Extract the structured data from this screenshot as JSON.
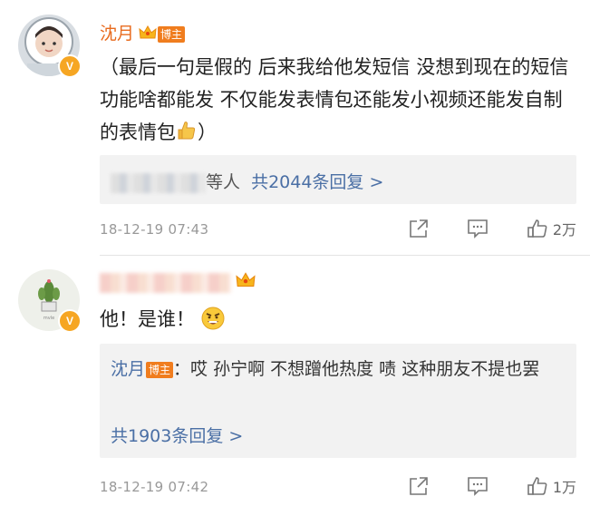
{
  "comments": [
    {
      "username": "沈月",
      "badge": "博主",
      "text": "（最后一句是假的 后来我给他发短信 没想到现在的短信功能啥都能发 不仅能发表情包还能发小视频还能发自制的表情包",
      "text_end": "）",
      "emoji": "thumbs-up",
      "replies_suffix": "等人",
      "replies_count": "共2044条回复 >",
      "timestamp": "18-12-19 07:43",
      "likes": "2万",
      "verified": "V"
    },
    {
      "username": "",
      "text": "他！是谁！",
      "emoji": "angry-face",
      "reply": {
        "author": "沈月",
        "badge": "博主",
        "text": "：哎 孙宁啊 不想蹭他热度 啧 这种朋友不提也罢",
        "count": "共1903条回复 >"
      },
      "timestamp": "18-12-19 07:42",
      "likes": "1万",
      "verified": "V"
    }
  ]
}
